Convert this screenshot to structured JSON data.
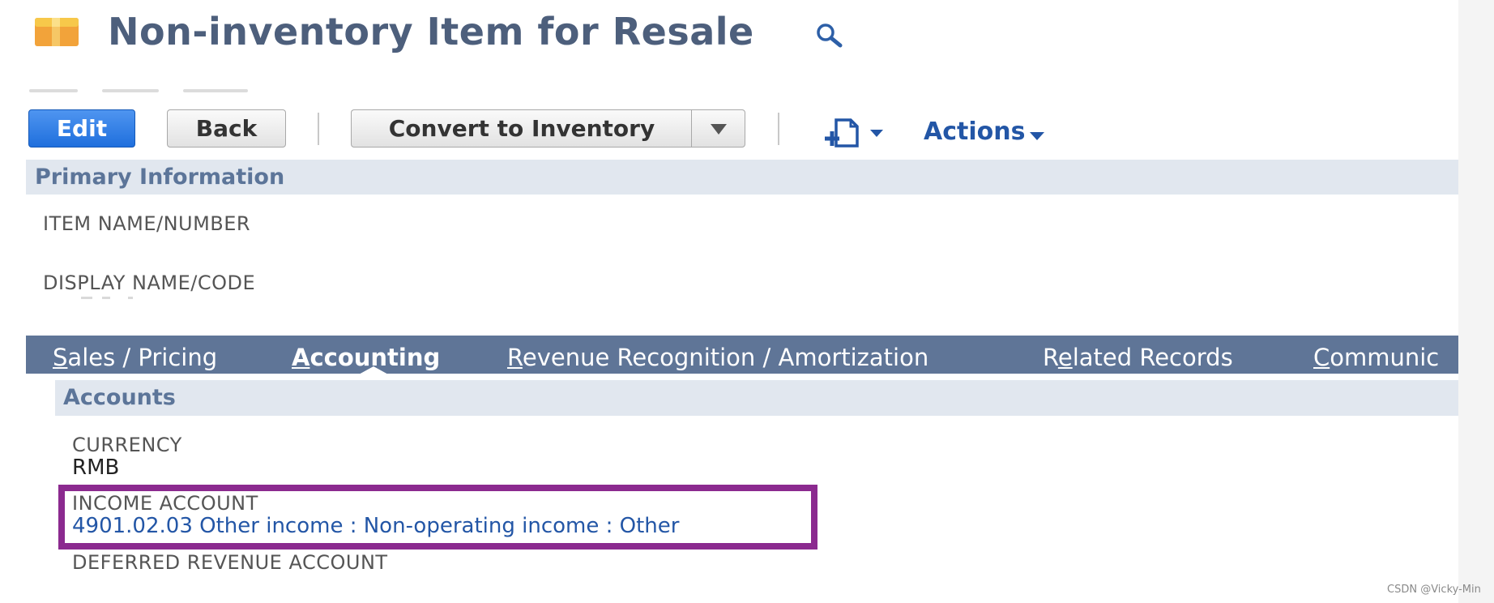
{
  "header": {
    "title": "Non-inventory Item for Resale"
  },
  "toolbar": {
    "edit_label": "Edit",
    "back_label": "Back",
    "convert_label": "Convert to Inventory",
    "actions_label": "Actions"
  },
  "primary_info": {
    "section_title": "Primary Information",
    "item_name_label": "ITEM NAME/NUMBER",
    "display_name_label": "DISPLAY NAME/CODE"
  },
  "tabs": [
    {
      "label": "Sales / Pricing",
      "access_key": "S",
      "rest": "ales / Pricing",
      "pre": "",
      "active": false
    },
    {
      "label": "Accounting",
      "access_key": "A",
      "rest": "ccounting",
      "pre": "",
      "active": true
    },
    {
      "label": "Revenue Recognition / Amortization",
      "access_key": "R",
      "rest": "evenue Recognition / Amortization",
      "pre": "",
      "active": false
    },
    {
      "label": "Related Records",
      "access_key": "e",
      "rest": "lated Records",
      "pre": "R",
      "active": false
    },
    {
      "label": "Communic",
      "access_key": "C",
      "rest": "ommunic",
      "pre": "",
      "active": false
    }
  ],
  "accounts": {
    "section_title": "Accounts",
    "currency_label": "CURRENCY",
    "currency_value": "RMB",
    "income_account_label": "INCOME ACCOUNT",
    "income_account_value": "4901.02.03 Other income : Non-operating income : Other",
    "deferred_revenue_label": "DEFERRED REVENUE ACCOUNT"
  },
  "annotation": {
    "highlight_color": "#8b2a8f"
  },
  "watermark": "CSDN @Vicky-Min",
  "colors": {
    "title": "#4d5f7c",
    "primary_button": "#2a78e4",
    "tab_bar": "#5f7597",
    "section_bar": "#e1e7ef",
    "link": "#2356a6"
  },
  "icons": {
    "record_type": "package-icon",
    "search": "search-icon",
    "new_record": "new-record-icon",
    "dropdown": "chevron-down-icon"
  }
}
